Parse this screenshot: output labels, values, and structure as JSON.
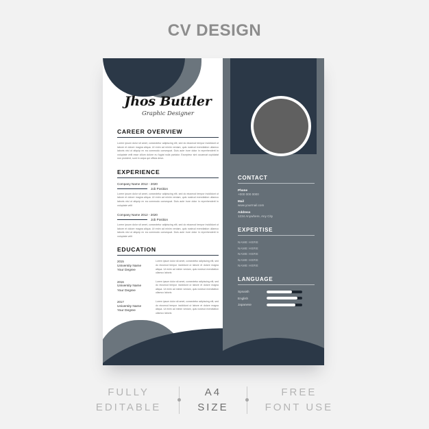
{
  "header": {
    "title": "CV DESIGN"
  },
  "colors": {
    "navy": "#2b3847",
    "slate": "#656f77",
    "slate_light": "#6b757d",
    "page_bg": "#f2f2f2",
    "paper": "#ffffff",
    "photo_fill": "#606060"
  },
  "cv": {
    "name": "Jhos Buttler",
    "role": "Graphic Designer",
    "career": {
      "heading": "CAREER OVERVIEW",
      "body": "Lorem ipsum dolor sit amet, consectetur adipiscing elit, sed do eiusmod tempor incididunt ut labore et dolore magna aliqua. Ut enim ad minim veniam, quis nostrud exercitation ullamco laboris nisi ut aliquip ex ea commodo consequat. Duis aute irure dolor in reprehenderit in voluptate velit esse cillum dolore eu fugiat nulla pariatur. Excepteur sint occaecat cupidatat non proident, sunt in culpa qui officia dese-"
    },
    "experience": {
      "heading": "EXPERIENCE",
      "entries": [
        {
          "company": "Company Name 2012 - 2020",
          "position": "Job Position",
          "description": "Lorem ipsum dolor sit amet, consectetur adipiscing elit, sed do eiusmod tempor incididunt ut labore et dolore magna aliqua. Ut enim ad minim veniam, quis nostrud exercitation ullamco laboris nisi ut aliquip ex ea commodo consequat. Duis aute irure dolor in reprehenderit in voluptate velit"
        },
        {
          "company": "Company Name 2012 - 2020",
          "position": "Job Position",
          "description": "Lorem ipsum dolor sit amet, consectetur adipiscing elit, sed do eiusmod tempor incididunt ut labore et dolore magna aliqua. Ut enim ad minim veniam, quis nostrud exercitation ullamco laboris nisi ut aliquip ex ea commodo consequat. Duis aute irure dolor in reprehenderit in voluptate velit"
        }
      ]
    },
    "education": {
      "heading": "EDUCATION",
      "entries": [
        {
          "year": "2015",
          "school": "University Name",
          "degree": "Your Degree",
          "description": "Lorem ipsum dolor sit amet, consectetur adipiscing elit, sed do eiusmod tempor incididunt ut labore et dolore magna aliqua. Ut enim ad minim veniam, quis nostrud exercitation ullamco laboris"
        },
        {
          "year": "2016",
          "school": "University Name",
          "degree": "Your Degree",
          "description": "Lorem ipsum dolor sit amet, consectetur adipiscing elit, sed do eiusmod tempor incididunt ut labore et dolore magna aliqua. Ut enim ad minim veniam, quis nostrud exercitation ullamco laboris"
        },
        {
          "year": "2017",
          "school": "University Name",
          "degree": "Your Degree",
          "description": "Lorem ipsum dolor sit amet, consectetur adipiscing elit, sed do eiusmod tempor incididunt ut labore et dolore magna aliqua. Ut enim ad minim veniam, quis nostrud exercitation ullamco laboris"
        }
      ]
    },
    "contact": {
      "heading": "CONTACT",
      "items": [
        {
          "label": "Phone",
          "value": "+000 000 0000"
        },
        {
          "label": "Mail",
          "value": "www.yourmail.com"
        },
        {
          "label": "Address",
          "value": "1234 Anywhere, Any City"
        }
      ]
    },
    "expertise": {
      "heading": "EXPERTISE",
      "items": [
        "NAME HERE",
        "NAME HERE",
        "NAME HERE",
        "NAME HERE",
        "NAME HERE"
      ]
    },
    "language": {
      "heading": "LANGUAGE",
      "items": [
        {
          "name": "Spnaish",
          "level": 72
        },
        {
          "name": "English",
          "level": 86
        },
        {
          "name": "Japanese",
          "level": 80
        }
      ]
    },
    "photo": {
      "alt": "profile-photo-placeholder"
    }
  },
  "features": [
    {
      "line1": "FULLY",
      "line2": "EDITABLE",
      "emphasis": false
    },
    {
      "line1": "A4",
      "line2": "SIZE",
      "emphasis": true
    },
    {
      "line1": "FREE",
      "line2": "FONT USE",
      "emphasis": false
    }
  ]
}
